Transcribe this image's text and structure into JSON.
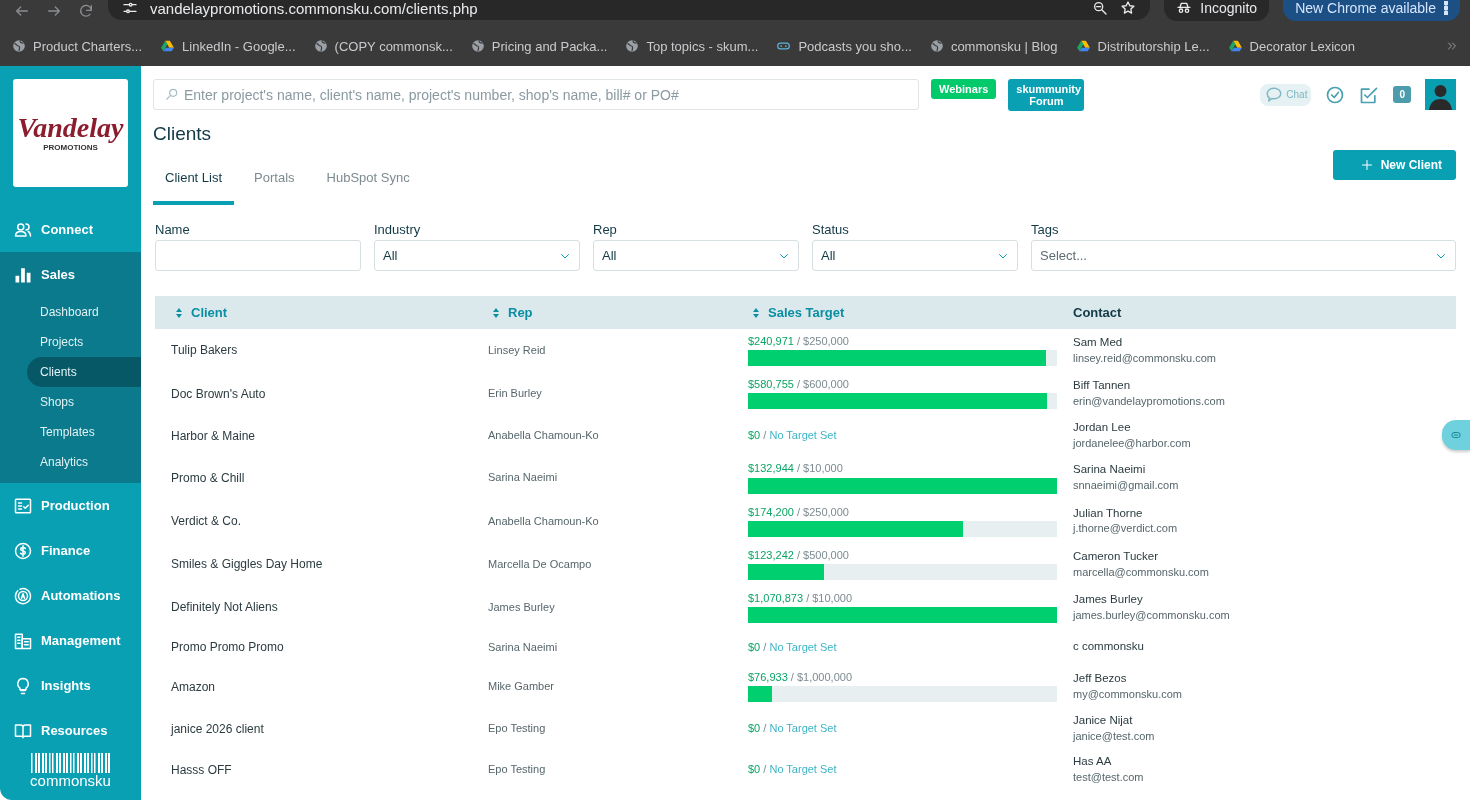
{
  "browser": {
    "url": "vandelaypromotions.commonsku.com/clients.php",
    "profile": "Incognito",
    "update_button": "New Chrome available",
    "bookmarks": [
      {
        "label": "Product Charters..."
      },
      {
        "label": "LinkedIn - Google..."
      },
      {
        "label": "(COPY commonsk..."
      },
      {
        "label": "Pricing and Packa..."
      },
      {
        "label": "Top topics - skum..."
      },
      {
        "label": "Podcasts you sho..."
      },
      {
        "label": "commonsku | Blog"
      },
      {
        "label": "Distributorship Le..."
      },
      {
        "label": "Decorator Lexicon"
      }
    ]
  },
  "sidebar": {
    "logo": {
      "title": "Vandelay",
      "subtitle": "PROMOTIONS"
    },
    "items": [
      {
        "label": "Connect",
        "expanded": false
      },
      {
        "label": "Sales",
        "expanded": true,
        "children": [
          {
            "label": "Dashboard",
            "selected": false
          },
          {
            "label": "Projects",
            "selected": false
          },
          {
            "label": "Clients",
            "selected": true
          },
          {
            "label": "Shops",
            "selected": false
          },
          {
            "label": "Templates",
            "selected": false
          },
          {
            "label": "Analytics",
            "selected": false
          }
        ]
      },
      {
        "label": "Production",
        "expanded": false
      },
      {
        "label": "Finance",
        "expanded": false
      },
      {
        "label": "Automations",
        "expanded": false
      },
      {
        "label": "Management",
        "expanded": false
      },
      {
        "label": "Insights",
        "expanded": false
      },
      {
        "label": "Resources",
        "expanded": false
      }
    ],
    "footer_logo": "commonsku"
  },
  "header": {
    "search": {
      "placeholder": "Enter project's name, client's name, project's number, shop's name, bill# or PO#"
    },
    "buttons": [
      {
        "label": "Webinars",
        "kind": "green"
      },
      {
        "label": "skummunity Forum",
        "kind": "teal"
      }
    ],
    "chat": "Chat",
    "notification_count": "0"
  },
  "page": {
    "title": "Clients",
    "tabs": [
      {
        "label": "Client List",
        "selected": true
      },
      {
        "label": "Portals",
        "selected": false
      },
      {
        "label": "HubSpot Sync",
        "selected": false
      }
    ],
    "new_button": "New Client"
  },
  "filters": [
    {
      "label": "Name",
      "kind": "text"
    },
    {
      "label": "Industry",
      "kind": "select",
      "value": "All"
    },
    {
      "label": "Rep",
      "kind": "select",
      "value": "All"
    },
    {
      "label": "Status",
      "kind": "select",
      "value": "All"
    },
    {
      "label": "Tags",
      "kind": "select",
      "placeholder": "Select..."
    }
  ],
  "table": {
    "columns": [
      {
        "label": "Client",
        "sortable": true
      },
      {
        "label": "Rep",
        "sortable": true
      },
      {
        "label": "Sales Target",
        "sortable": true
      },
      {
        "label": "Contact",
        "sortable": false
      }
    ],
    "rows": [
      {
        "client": "Tulip Bakers",
        "rep": "Linsey Reid",
        "sales": {
          "kind": "target",
          "achieved": "$240,971",
          "separator": "/",
          "target": "$250,000",
          "level": 0.964
        },
        "contact": {
          "name": "Sam Med",
          "email": "linsey.reid@commonsku.com"
        }
      },
      {
        "client": "Doc Brown's Auto",
        "rep": "Erin Burley",
        "sales": {
          "kind": "target",
          "achieved": "$580,755",
          "separator": "/",
          "target": "$600,000",
          "level": 0.968
        },
        "contact": {
          "name": "Biff Tannen",
          "email": "erin@vandelaypromotions.com"
        }
      },
      {
        "client": "Harbor & Maine",
        "rep": "Anabella Chamoun-Ko",
        "sales": {
          "kind": "none",
          "achieved": "$0",
          "separator": "/",
          "target": "No Target Set"
        },
        "contact": {
          "name": "Jordan Lee",
          "email": "jordanelee@harbor.com"
        }
      },
      {
        "client": "Promo & Chill",
        "rep": "Sarina Naeimi",
        "sales": {
          "kind": "target",
          "achieved": "$132,944",
          "separator": "/",
          "target": "$10,000",
          "level": 1
        },
        "contact": {
          "name": "Sarina Naeimi",
          "email": "snnaeimi@gmail.com"
        }
      },
      {
        "client": "Verdict & Co.",
        "rep": "Anabella Chamoun-Ko",
        "sales": {
          "kind": "target",
          "achieved": "$174,200",
          "separator": "/",
          "target": "$250,000",
          "level": 0.697
        },
        "contact": {
          "name": "Julian Thorne",
          "email": "j.thorne@verdict.com"
        }
      },
      {
        "client": "Smiles & Giggles Day Home",
        "rep": "Marcella De Ocampo",
        "sales": {
          "kind": "target",
          "achieved": "$123,242",
          "separator": "/",
          "target": "$500,000",
          "level": 0.246
        },
        "contact": {
          "name": "Cameron Tucker",
          "email": "marcella@commonsku.com"
        }
      },
      {
        "client": "Definitely Not Aliens",
        "rep": "James Burley",
        "sales": {
          "kind": "target",
          "achieved": "$1,070,873",
          "separator": "/",
          "target": "$10,000",
          "level": 1
        },
        "contact": {
          "name": "James Burley",
          "email": "james.burley@commonsku.com"
        }
      },
      {
        "client": "Promo Promo Promo",
        "rep": "Sarina Naeimi",
        "sales": {
          "kind": "none",
          "achieved": "$0",
          "separator": "/",
          "target": "No Target Set"
        },
        "contact": {
          "name": "c commonsku"
        }
      },
      {
        "client": "Amazon",
        "rep": "Mike Gamber",
        "sales": {
          "kind": "target",
          "achieved": "$76,933",
          "separator": "/",
          "target": "$1,000,000",
          "level": 0.077
        },
        "contact": {
          "name": "Jeff Bezos",
          "email": "my@commonsku.com"
        }
      },
      {
        "client": "janice 2026 client",
        "rep": "Epo Testing",
        "sales": {
          "kind": "none",
          "achieved": "$0",
          "separator": "/",
          "target": "No Target Set"
        },
        "contact": {
          "name": "Janice Nijat",
          "email": "janice@test.com"
        }
      },
      {
        "client": "Hasss OFF",
        "rep": "Epo Testing",
        "sales": {
          "kind": "none",
          "achieved": "$0",
          "separator": "/",
          "target": "No Target Set"
        },
        "contact": {
          "name": "Has AA",
          "email": "test@test.com"
        }
      }
    ]
  }
}
